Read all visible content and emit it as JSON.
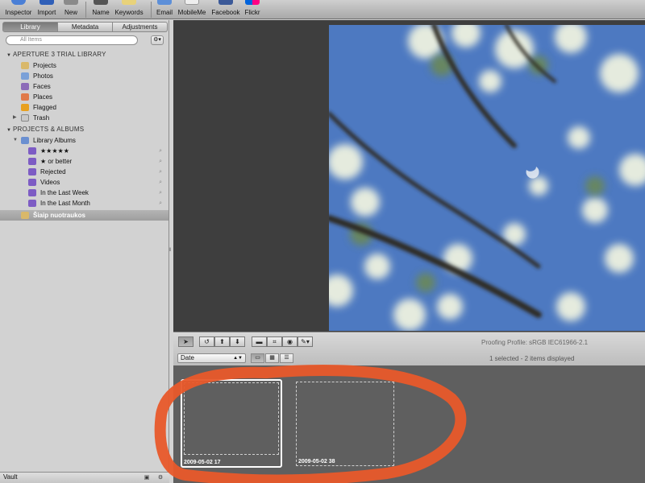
{
  "toolbar": {
    "buttons": [
      {
        "label": "Inspector",
        "icon": "info-icon"
      },
      {
        "label": "Import",
        "icon": "import-icon"
      },
      {
        "label": "New",
        "icon": "new-icon"
      },
      {
        "label": "Name",
        "icon": "name-stamp-icon"
      },
      {
        "label": "Keywords",
        "icon": "keywords-icon"
      },
      {
        "label": "Email",
        "icon": "email-icon"
      },
      {
        "label": "MobileMe",
        "icon": "mobileme-icon"
      },
      {
        "label": "Facebook",
        "icon": "facebook-icon"
      },
      {
        "label": "Flickr",
        "icon": "flickr-icon"
      }
    ]
  },
  "left_panel": {
    "tabs": [
      "Library",
      "Metadata",
      "Adjustments"
    ],
    "active_tab": "Library",
    "search_placeholder": "All Items",
    "sections": {
      "library_header": "APERTURE 3 TRIAL LIBRARY",
      "library_items": [
        "Projects",
        "Photos",
        "Faces",
        "Places",
        "Flagged",
        "Trash"
      ],
      "projects_header": "PROJECTS & ALBUMS",
      "library_albums_label": "Library Albums",
      "albums": [
        "★★★★★",
        "★ or better",
        "Rejected",
        "Videos",
        "In the Last Week",
        "In the Last Month"
      ],
      "selected_project": "Šiaip nuotraukos"
    },
    "vault_label": "Vault"
  },
  "browser_toolbar": {
    "proofing_profile": "Proofing Profile: sRGB IEC61966-2.1",
    "sort_value": "Date",
    "selection_status": "1 selected - 2 items displayed"
  },
  "thumbnails": [
    {
      "caption": "2009-05-02  17",
      "selected": true
    },
    {
      "caption": "2009-05-02  38",
      "selected": false
    }
  ],
  "colors": {
    "annotation": "#e8582a",
    "sky": "#4f7bc3",
    "browser_bg": "#5f5f5f",
    "viewer_bg": "#3e3e3e"
  }
}
